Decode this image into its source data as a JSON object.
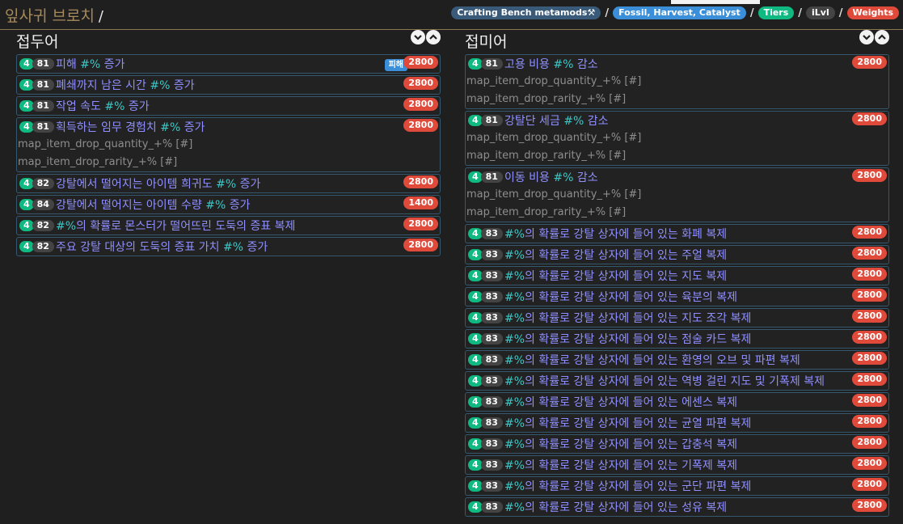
{
  "header": {
    "title": "잎사귀 브로치",
    "slash": "/",
    "crumbs": [
      {
        "label": "Crafting Bench metamods⚒",
        "color": "#3a5a7a"
      },
      {
        "label": "Fossil, Harvest, Catalyst",
        "color": "#3a8fd8"
      },
      {
        "label": "Tiers",
        "color": "#10b981"
      },
      {
        "label": "iLvl",
        "color": "#444444"
      },
      {
        "label": "Weights",
        "color": "#e04a3a"
      }
    ]
  },
  "prefix": {
    "title": "접두어",
    "mods": [
      {
        "tier": "4",
        "ilvl": "81",
        "pre": "피해 ",
        "val": "#%",
        "post": " 증가",
        "tag": "피해",
        "weight": "2800",
        "stats": []
      },
      {
        "tier": "4",
        "ilvl": "81",
        "pre": "폐쇄까지 남은 시간 ",
        "val": "#%",
        "post": " 증가",
        "weight": "2800",
        "stats": []
      },
      {
        "tier": "4",
        "ilvl": "81",
        "pre": "작업 속도 ",
        "val": "#%",
        "post": " 증가",
        "weight": "2800",
        "stats": []
      },
      {
        "tier": "4",
        "ilvl": "81",
        "pre": "획득하는 임무 경험치 ",
        "val": "#%",
        "post": " 증가",
        "weight": "2800",
        "stats": [
          "map_item_drop_quantity_+% [#]",
          "map_item_drop_rarity_+% [#]"
        ]
      },
      {
        "tier": "4",
        "ilvl": "82",
        "pre": "강탈에서 떨어지는 아이템 희귀도 ",
        "val": "#%",
        "post": " 증가",
        "weight": "2800",
        "stats": []
      },
      {
        "tier": "4",
        "ilvl": "84",
        "pre": "강탈에서 떨어지는 아이템 수량 ",
        "val": "#%",
        "post": " 증가",
        "weight": "1400",
        "stats": []
      },
      {
        "tier": "4",
        "ilvl": "82",
        "pre": "",
        "val": "#%",
        "post": "의 확률로 몬스터가 떨어뜨린 도둑의 증표 복제",
        "weight": "2800",
        "stats": []
      },
      {
        "tier": "4",
        "ilvl": "82",
        "pre": "주요 강탈 대상의 도둑의 증표 가치 ",
        "val": "#%",
        "post": " 증가",
        "weight": "2800",
        "stats": []
      }
    ]
  },
  "suffix": {
    "title": "접미어",
    "mods": [
      {
        "tier": "4",
        "ilvl": "81",
        "pre": "고용 비용 ",
        "val": "#%",
        "post": " 감소",
        "weight": "2800",
        "stats": [
          "map_item_drop_quantity_+% [#]",
          "map_item_drop_rarity_+% [#]"
        ]
      },
      {
        "tier": "4",
        "ilvl": "81",
        "pre": "강탈단 세금 ",
        "val": "#%",
        "post": " 감소",
        "weight": "2800",
        "stats": [
          "map_item_drop_quantity_+% [#]",
          "map_item_drop_rarity_+% [#]"
        ]
      },
      {
        "tier": "4",
        "ilvl": "81",
        "pre": "이동 비용 ",
        "val": "#%",
        "post": " 감소",
        "weight": "2800",
        "stats": [
          "map_item_drop_quantity_+% [#]",
          "map_item_drop_rarity_+% [#]"
        ]
      },
      {
        "tier": "4",
        "ilvl": "83",
        "pre": "",
        "val": "#%",
        "post": "의 확률로 강탈 상자에 들어 있는 화폐 복제",
        "weight": "2800",
        "stats": []
      },
      {
        "tier": "4",
        "ilvl": "83",
        "pre": "",
        "val": "#%",
        "post": "의 확률로 강탈 상자에 들어 있는 주얼 복제",
        "weight": "2800",
        "stats": []
      },
      {
        "tier": "4",
        "ilvl": "83",
        "pre": "",
        "val": "#%",
        "post": "의 확률로 강탈 상자에 들어 있는 지도 복제",
        "weight": "2800",
        "stats": []
      },
      {
        "tier": "4",
        "ilvl": "83",
        "pre": "",
        "val": "#%",
        "post": "의 확률로 강탈 상자에 들어 있는 육분의 복제",
        "weight": "2800",
        "stats": []
      },
      {
        "tier": "4",
        "ilvl": "83",
        "pre": "",
        "val": "#%",
        "post": "의 확률로 강탈 상자에 들어 있는 지도 조각 복제",
        "weight": "2800",
        "stats": []
      },
      {
        "tier": "4",
        "ilvl": "83",
        "pre": "",
        "val": "#%",
        "post": "의 확률로 강탈 상자에 들어 있는 점술 카드 복제",
        "weight": "2800",
        "stats": []
      },
      {
        "tier": "4",
        "ilvl": "83",
        "pre": "",
        "val": "#%",
        "post": "의 확률로 강탈 상자에 들어 있는 환영의 오브 및 파편 복제",
        "weight": "2800",
        "stats": []
      },
      {
        "tier": "4",
        "ilvl": "83",
        "pre": "",
        "val": "#%",
        "post": "의 확률로 강탈 상자에 들어 있는 역병 걸린 지도 및 기폭제 복제",
        "weight": "2800",
        "stats": []
      },
      {
        "tier": "4",
        "ilvl": "83",
        "pre": "",
        "val": "#%",
        "post": "의 확률로 강탈 상자에 들어 있는 에센스 복제",
        "weight": "2800",
        "stats": []
      },
      {
        "tier": "4",
        "ilvl": "83",
        "pre": "",
        "val": "#%",
        "post": "의 확률로 강탈 상자에 들어 있는 균열 파편 복제",
        "weight": "2800",
        "stats": []
      },
      {
        "tier": "4",
        "ilvl": "83",
        "pre": "",
        "val": "#%",
        "post": "의 확률로 강탈 상자에 들어 있는 갑충석 복제",
        "weight": "2800",
        "stats": []
      },
      {
        "tier": "4",
        "ilvl": "83",
        "pre": "",
        "val": "#%",
        "post": "의 확률로 강탈 상자에 들어 있는 기폭제 복제",
        "weight": "2800",
        "stats": []
      },
      {
        "tier": "4",
        "ilvl": "83",
        "pre": "",
        "val": "#%",
        "post": "의 확률로 강탈 상자에 들어 있는 군단 파편 복제",
        "weight": "2800",
        "stats": []
      },
      {
        "tier": "4",
        "ilvl": "83",
        "pre": "",
        "val": "#%",
        "post": "의 확률로 강탈 상자에 들어 있는 성유 복제",
        "weight": "2800",
        "stats": []
      }
    ]
  }
}
